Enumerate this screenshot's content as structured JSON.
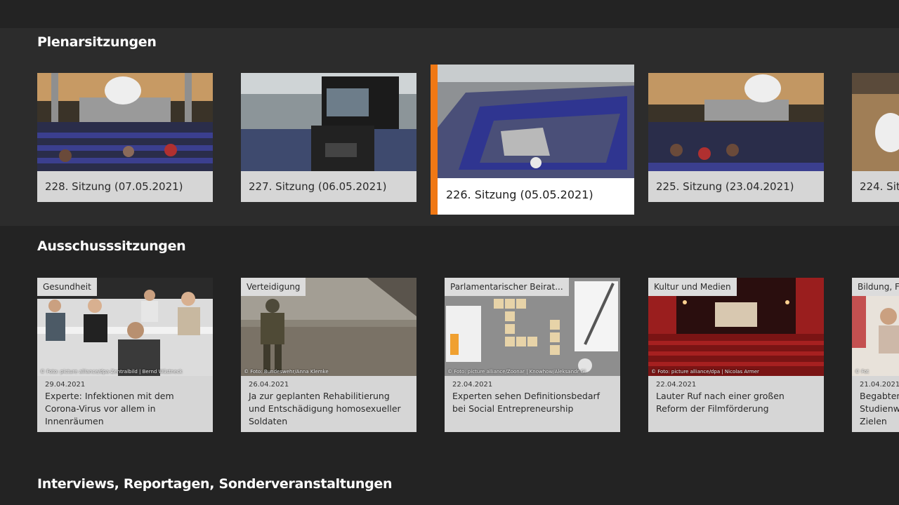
{
  "sections": {
    "plenar": {
      "title": "Plenarsitzungen",
      "items": [
        {
          "label": "228. Sitzung (07.05.2021)"
        },
        {
          "label": "227. Sitzung (06.05.2021)"
        },
        {
          "label": "226. Sitzung (05.05.2021)"
        },
        {
          "label": "225. Sitzung (23.04.2021)"
        },
        {
          "label": "224. Sitz"
        }
      ]
    },
    "ausschuss": {
      "title": "Ausschusssitzungen",
      "items": [
        {
          "category": "Gesundheit",
          "credit": "© Foto: picture alliance/dpa-Zentralbild | Bernd Wüstneck",
          "date": "29.04.2021",
          "text": "Experte: Infektionen mit dem Corona-Virus vor allem in Innenräumen"
        },
        {
          "category": "Verteidigung",
          "credit": "© Foto: Bundeswehr/Anna Klemke",
          "date": "26.04.2021",
          "text": "Ja zur geplanten Rehabilitierung und Entschädigung homosexueller Soldaten"
        },
        {
          "category": "Parlamentarischer Beirat...",
          "credit": "© Foto: picture alliance/Zoonar | Knowhow/Aleksandr Gl",
          "date": "22.04.2021",
          "text": "Experten sehen Definitionsbedarf bei Social Entrepreneurship"
        },
        {
          "category": "Kultur und Medien",
          "credit": "© Foto: picture alliance/dpa | Nicolas Armer",
          "date": "22.04.2021",
          "text": "Lauter Ruf nach einer großen Reform der Filmförderung"
        },
        {
          "category": "Bildung, F",
          "credit": "© Fot",
          "date": "21.04.2021",
          "text": "Begabten Studienw Zielen"
        }
      ]
    },
    "interviews": {
      "title": "Interviews, Reportagen, Sonderveranstaltungen"
    }
  },
  "colors": {
    "accent": "#f07814",
    "background": "#232323",
    "section_band": "#2c2c2c",
    "card_label": "#d6d6d6"
  },
  "focused_item": "226. Sitzung (05.05.2021)"
}
